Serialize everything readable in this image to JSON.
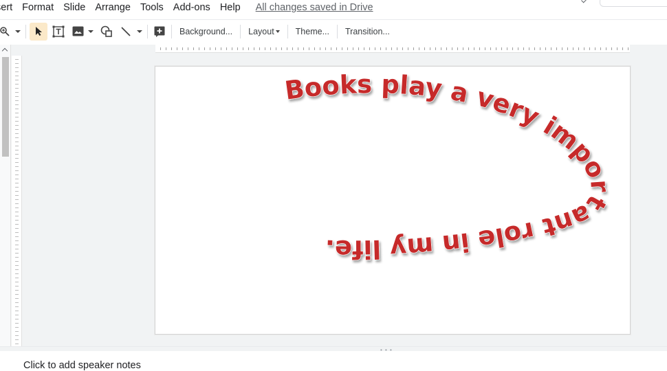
{
  "menu": {
    "items": [
      "sert",
      "Format",
      "Slide",
      "Arrange",
      "Tools",
      "Add-ons",
      "Help"
    ],
    "saved_status": "All changes saved in Drive"
  },
  "toolbar": {
    "zoom_icon": "zoom-icon",
    "select_icon": "cursor-arrow-icon",
    "textbox_icon": "textbox-icon",
    "image_icon": "image-icon",
    "shape_icon": "shape-icon",
    "line_icon": "line-icon",
    "comment_icon": "add-comment-icon",
    "background_label": "Background...",
    "layout_label": "Layout",
    "theme_label": "Theme...",
    "transition_label": "Transition..."
  },
  "slide": {
    "wordart_text": "Books play a very important role in my life.",
    "text_color": "#c62b2b"
  },
  "notes": {
    "placeholder": "Click to add speaker notes"
  }
}
